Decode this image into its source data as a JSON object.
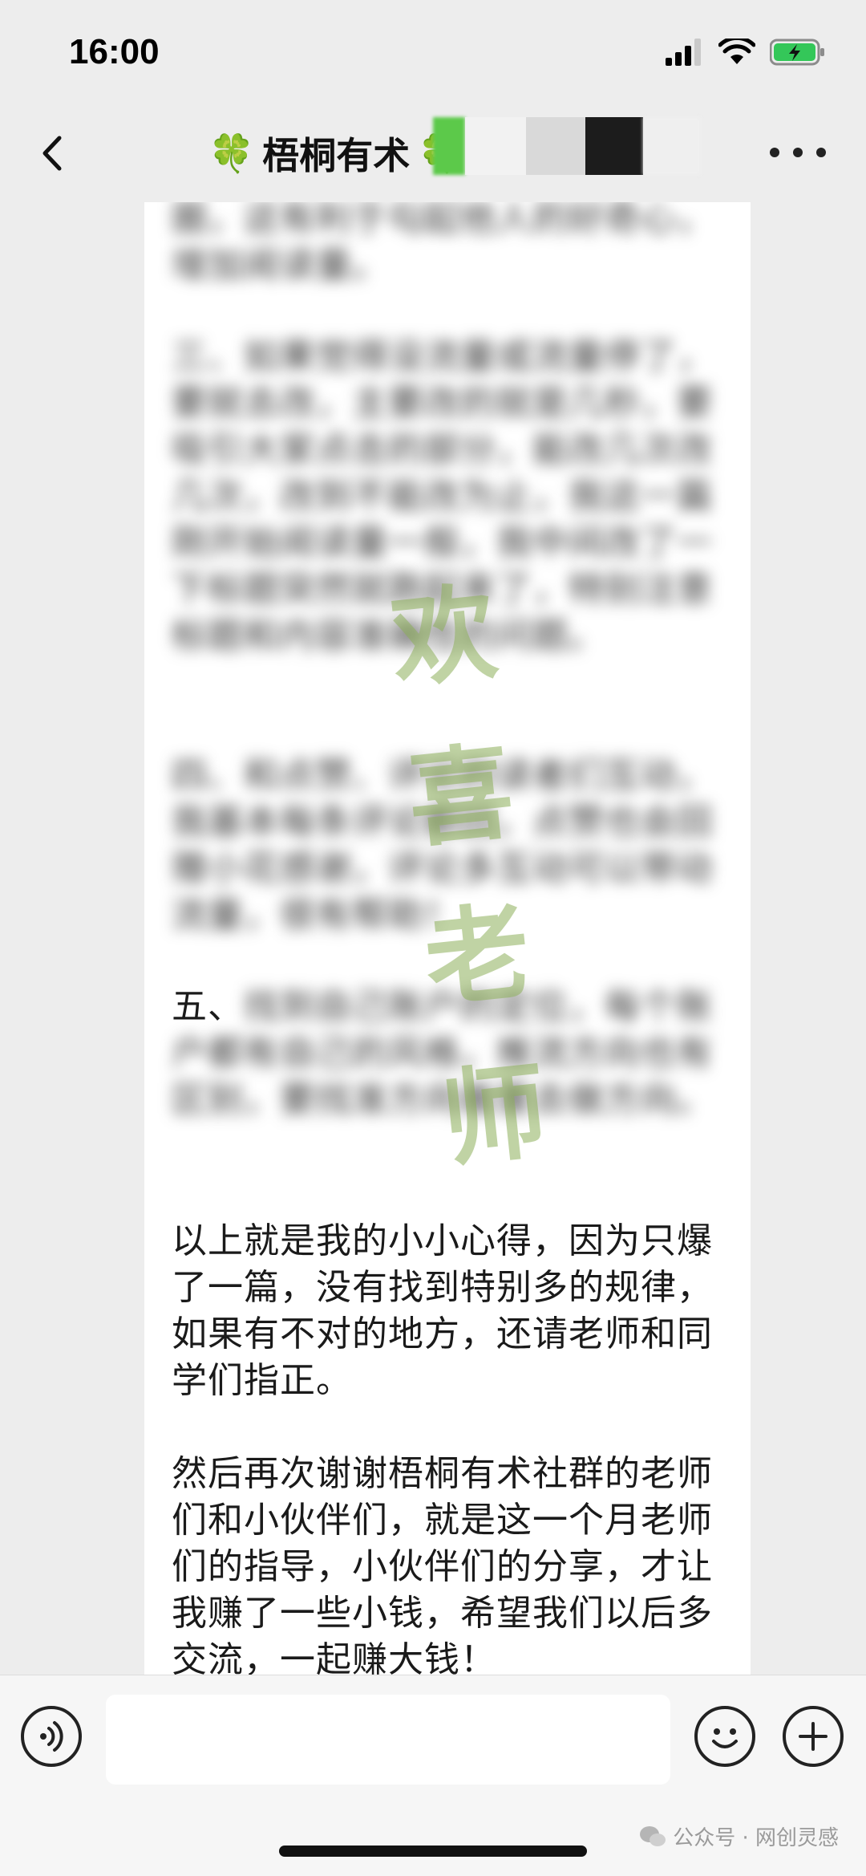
{
  "status_bar": {
    "time": "16:00"
  },
  "nav": {
    "clover": "🍀",
    "title": "梧桐有术"
  },
  "message": {
    "blurred_paragraphs": [
      "圈，这有利于勾起他人的好奇心，增加阅读量。",
      "三、如果觉得没流量或流量停了，要就去改，主要改的就是几秒，要吸引大家点击的部分，能改几次改几次，改到不能改为止，我这一篇刚开始阅读量一般，我中间改了一下标题突然就跑起来了，特别注意标题和内容准确性的问题。",
      "四、和点赞、评论的读者们互动，我基本每条评论都回，点赞也会回赠小花感谢，评论多互动可以带动流量，很有帮助！"
    ],
    "para5_label": "五、",
    "para5_blurred": "找到自己账户的定位，每个账户都有自己的风格，推流方向也有区别，要找准方向着重去做方向。",
    "para6": "以上就是我的小小心得，因为只爆了一篇，没有找到特别多的规律，如果有不对的地方，还请老师和同学们指正。",
    "para7": "然后再次谢谢梧桐有术社群的老师们和小伙伴们，就是这一个月老师们的指导，小伙伴们的分享，才让我赚了一些小钱，希望我们以后多交流，一起赚大钱！"
  },
  "watermark": [
    "欢",
    "喜",
    "老",
    "师"
  ],
  "footer": {
    "label": "公众号 · 网创灵感"
  }
}
